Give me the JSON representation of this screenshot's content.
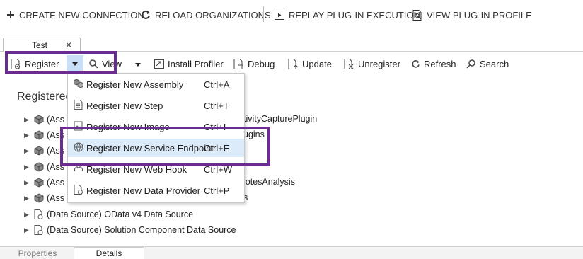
{
  "toolbar": {
    "create_connection": "CREATE NEW CONNECTION",
    "reload_orgs": "RELOAD ORGANIZATIONS",
    "replay": "REPLAY PLUG-IN EXECUTION",
    "view_profile": "VIEW PLUG-IN PROFILE"
  },
  "doc_tab": {
    "label": "Test",
    "close": "×"
  },
  "plugin_toolbar": {
    "register": "Register",
    "view": "View",
    "install_profiler": "Install Profiler",
    "debug": "Debug",
    "update": "Update",
    "unregister": "Unregister",
    "refresh": "Refresh",
    "search": "Search"
  },
  "main": {
    "heading": "Registered"
  },
  "tree": [
    {
      "prefix": "(Ass",
      "tail": "tivityCapturePlugin"
    },
    {
      "prefix": "(Ass",
      "tail": "ugins"
    },
    {
      "prefix": "(Ass",
      "tail": ""
    },
    {
      "prefix": "(Ass",
      "tail": ""
    },
    {
      "prefix": "(Ass",
      "tail": "lotesAnalysis"
    },
    {
      "prefix": "(Ass",
      "tail": "s"
    },
    {
      "prefix": "(Data Source) OData v4 Data Source",
      "tail": ""
    },
    {
      "prefix": "(Data Source) Solution Component Data Source",
      "tail": ""
    }
  ],
  "register_menu": [
    {
      "label": "Register New Assembly",
      "shortcut": "Ctrl+A"
    },
    {
      "label": "Register New Step",
      "shortcut": "Ctrl+T"
    },
    {
      "label": "Register New Image",
      "shortcut": "Ctrl+I"
    },
    {
      "label": "Register New Service Endpoint",
      "shortcut": "Ctrl+E"
    },
    {
      "label": "Register New Web Hook",
      "shortcut": "Ctrl+W"
    },
    {
      "label": "Register New Data Provider",
      "shortcut": "Ctrl+P"
    }
  ],
  "bottom_tabs": {
    "properties": "Properties",
    "details": "Details"
  },
  "colors": {
    "highlight": "#6b2c91",
    "menu_hover": "#dcebf9"
  }
}
